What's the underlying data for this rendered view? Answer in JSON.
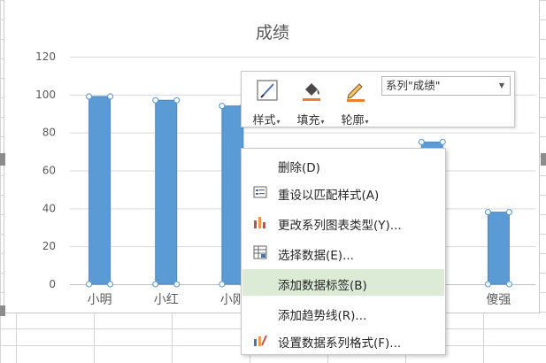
{
  "chart": {
    "title": "成绩",
    "bar_color": "#5b9bd5",
    "selection_color": "#5b9bd5"
  },
  "chart_data": {
    "type": "bar",
    "title": "成绩",
    "xlabel": "",
    "ylabel": "",
    "ylim": [
      0,
      120
    ],
    "yticks": [
      0,
      20,
      40,
      60,
      80,
      100,
      120
    ],
    "categories": [
      "小明",
      "小红",
      "小刚",
      "",
      "",
      "",
      "傻强"
    ],
    "series": [
      {
        "values": [
          99,
          97,
          94,
          null,
          null,
          75,
          38
        ]
      }
    ],
    "grid": true,
    "legend": "none"
  },
  "mini_toolbar": {
    "style_label": "样式",
    "fill_label": "填充",
    "outline_label": "轮廓",
    "series_select": "系列\"成绩\"",
    "fill_color": "#ed7d31",
    "outline_color": "#ed7d31"
  },
  "context_menu": {
    "items": [
      {
        "label": "删除(D)",
        "icon": "",
        "active": false
      },
      {
        "label": "重设以匹配样式(A)",
        "icon": "reset-style-icon",
        "active": false
      },
      {
        "label": "更改系列图表类型(Y)...",
        "icon": "chart-type-icon",
        "active": false
      },
      {
        "label": "选择数据(E)...",
        "icon": "select-data-icon",
        "active": false
      },
      {
        "label": "添加数据标签(B)",
        "icon": "",
        "active": true
      },
      {
        "label": "添加趋势线(R)...",
        "icon": "",
        "active": false
      },
      {
        "label": "设置数据系列格式(F)...",
        "icon": "format-series-icon",
        "active": false
      }
    ],
    "active_color": "#dcebd6"
  }
}
